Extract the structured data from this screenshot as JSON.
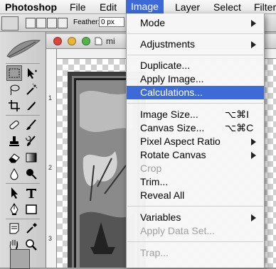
{
  "menubar": {
    "app": "Photoshop",
    "items": [
      "File",
      "Edit",
      "Image",
      "Layer",
      "Select",
      "Filter"
    ],
    "active": "Image"
  },
  "options_bar": {
    "feather_label": "Feather:",
    "feather_value": "0 px"
  },
  "document": {
    "title": "mi",
    "ruler_left_marks": [
      "1",
      "2",
      "3"
    ]
  },
  "image_menu": {
    "mode": "Mode",
    "adjustments": "Adjustments",
    "duplicate": "Duplicate...",
    "apply_image": "Apply Image...",
    "calculations": "Calculations...",
    "image_size": "Image Size...",
    "image_size_shortcut": "⌥⌘I",
    "canvas_size": "Canvas Size...",
    "canvas_size_shortcut": "⌥⌘C",
    "pixel_aspect_ratio": "Pixel Aspect Ratio",
    "rotate_canvas": "Rotate Canvas",
    "crop": "Crop",
    "trim": "Trim...",
    "reveal_all": "Reveal All",
    "variables": "Variables",
    "apply_data_set": "Apply Data Set...",
    "trap": "Trap..."
  },
  "colors": {
    "menu_highlight": "#3d6ad6",
    "disabled_text": "#a0a0a0"
  }
}
